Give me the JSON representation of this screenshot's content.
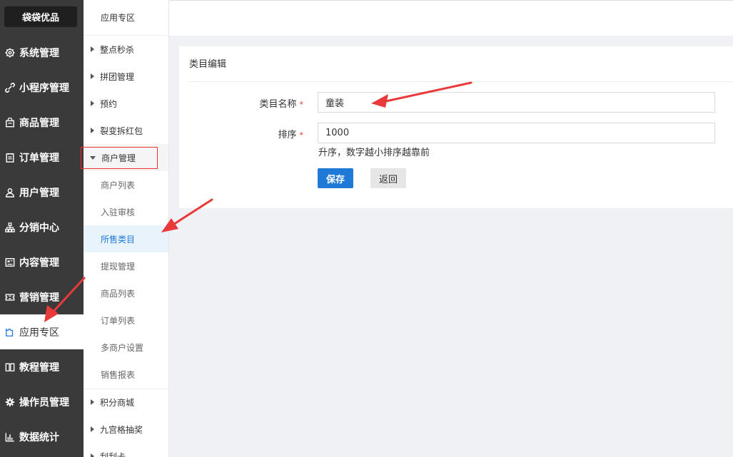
{
  "brand": "袋袋优品",
  "nav": [
    {
      "label": "系统管理",
      "icon": "gear-icon"
    },
    {
      "label": "小程序管理",
      "icon": "link-icon"
    },
    {
      "label": "商品管理",
      "icon": "bag-icon"
    },
    {
      "label": "订单管理",
      "icon": "clipboard-icon"
    },
    {
      "label": "用户管理",
      "icon": "user-icon"
    },
    {
      "label": "分销中心",
      "icon": "network-icon"
    },
    {
      "label": "内容管理",
      "icon": "content-icon"
    },
    {
      "label": "营销管理",
      "icon": "ticket-icon"
    },
    {
      "label": "应用专区",
      "icon": "puzzle-icon",
      "active": true
    },
    {
      "label": "教程管理",
      "icon": "book-icon"
    },
    {
      "label": "操作员管理",
      "icon": "cog-icon"
    },
    {
      "label": "数据统计",
      "icon": "bar-chart-icon"
    }
  ],
  "submenu": {
    "title": "应用专区",
    "groups_top": [
      "整点秒杀",
      "拼团管理",
      "预约",
      "裂变拆红包"
    ],
    "open_group": "商户管理",
    "items": [
      "商户列表",
      "入驻审核",
      "所售类目",
      "提现管理",
      "商品列表",
      "订单列表",
      "多商户设置",
      "销售报表"
    ],
    "active_item": "所售类目",
    "groups_bottom": [
      "积分商城",
      "九宫格抽奖",
      "刮刮卡"
    ]
  },
  "form": {
    "title": "类目编辑",
    "name_label": "类目名称",
    "name_value": "童装",
    "sort_label": "排序",
    "sort_value": "1000",
    "required_mark": "*",
    "sort_hint": "升序，数字越小排序越靠前",
    "save_label": "保存",
    "back_label": "返回"
  },
  "colors": {
    "sidebar": "#3a3a3a",
    "accent": "#1e7ad6",
    "annotation": "#e83a3a"
  }
}
